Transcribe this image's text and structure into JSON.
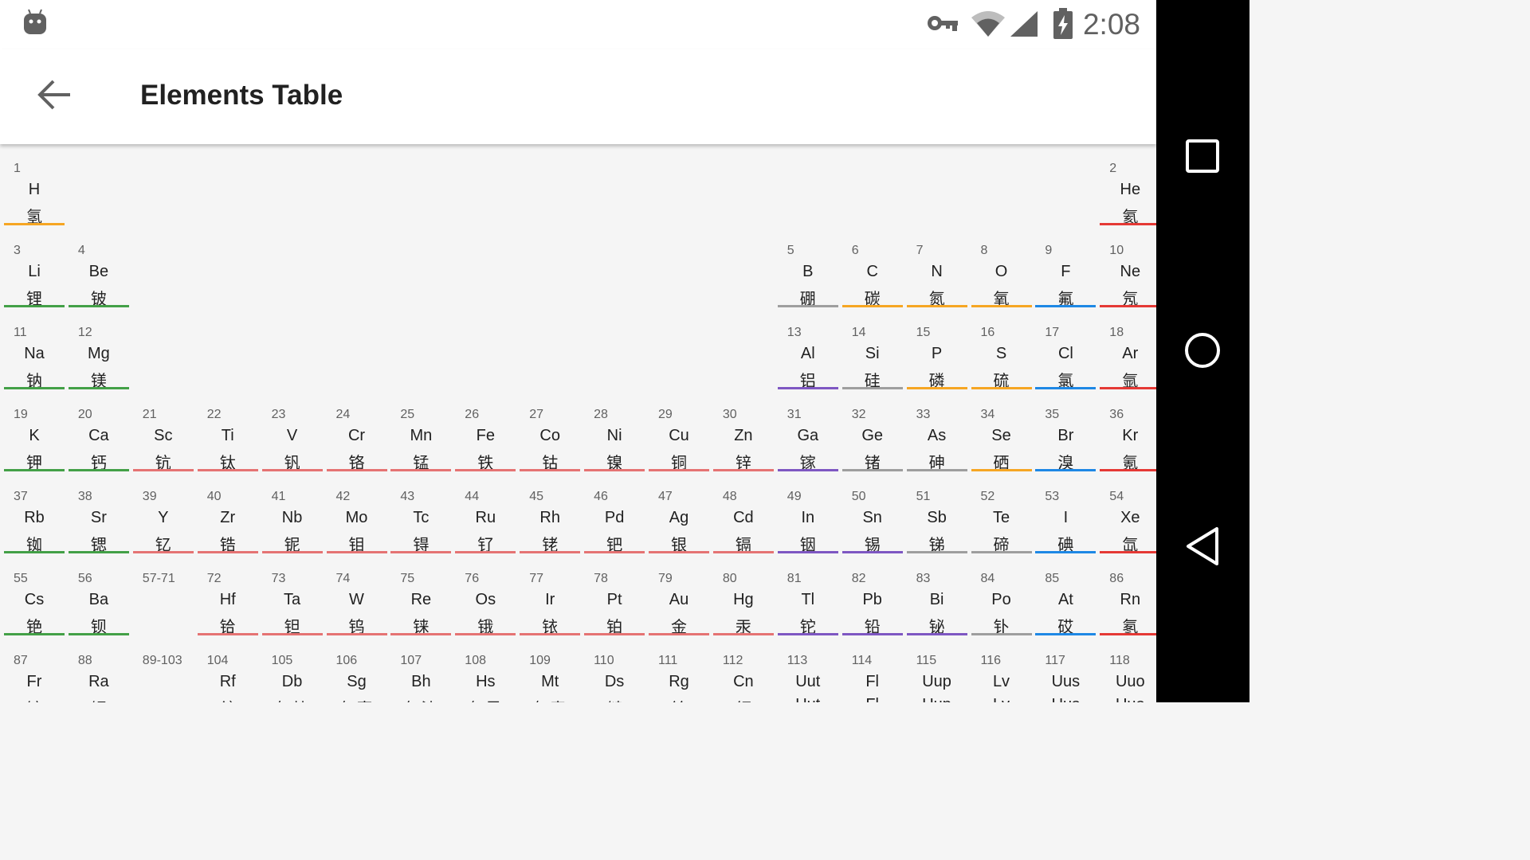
{
  "status_bar": {
    "time": "2:08"
  },
  "app_bar": {
    "title": "Elements Table"
  },
  "colors": {
    "h": "#f6a623",
    "nonmetal": "#f6a623",
    "noble": "#e53935",
    "alkali": "#43a047",
    "alkaline": "#43a047",
    "transition": "#e57373",
    "metalloid": "#9e9e9e",
    "post": "#7e57c2",
    "halogen": "#1e88e5",
    "none": "transparent"
  },
  "elements": [
    {
      "n": "1",
      "s": "H",
      "c": "氢",
      "row": 0,
      "col": 0,
      "cat": "h"
    },
    {
      "n": "2",
      "s": "He",
      "c": "氦",
      "row": 0,
      "col": 17,
      "cat": "noble"
    },
    {
      "n": "3",
      "s": "Li",
      "c": "锂",
      "row": 1,
      "col": 0,
      "cat": "alkali"
    },
    {
      "n": "4",
      "s": "Be",
      "c": "铍",
      "row": 1,
      "col": 1,
      "cat": "alkaline"
    },
    {
      "n": "5",
      "s": "B",
      "c": "硼",
      "row": 1,
      "col": 12,
      "cat": "metalloid"
    },
    {
      "n": "6",
      "s": "C",
      "c": "碳",
      "row": 1,
      "col": 13,
      "cat": "nonmetal"
    },
    {
      "n": "7",
      "s": "N",
      "c": "氮",
      "row": 1,
      "col": 14,
      "cat": "nonmetal"
    },
    {
      "n": "8",
      "s": "O",
      "c": "氧",
      "row": 1,
      "col": 15,
      "cat": "nonmetal"
    },
    {
      "n": "9",
      "s": "F",
      "c": "氟",
      "row": 1,
      "col": 16,
      "cat": "halogen"
    },
    {
      "n": "10",
      "s": "Ne",
      "c": "氖",
      "row": 1,
      "col": 17,
      "cat": "noble"
    },
    {
      "n": "11",
      "s": "Na",
      "c": "钠",
      "row": 2,
      "col": 0,
      "cat": "alkali"
    },
    {
      "n": "12",
      "s": "Mg",
      "c": "镁",
      "row": 2,
      "col": 1,
      "cat": "alkaline"
    },
    {
      "n": "13",
      "s": "Al",
      "c": "铝",
      "row": 2,
      "col": 12,
      "cat": "post"
    },
    {
      "n": "14",
      "s": "Si",
      "c": "硅",
      "row": 2,
      "col": 13,
      "cat": "metalloid"
    },
    {
      "n": "15",
      "s": "P",
      "c": "磷",
      "row": 2,
      "col": 14,
      "cat": "nonmetal"
    },
    {
      "n": "16",
      "s": "S",
      "c": "硫",
      "row": 2,
      "col": 15,
      "cat": "nonmetal"
    },
    {
      "n": "17",
      "s": "Cl",
      "c": "氯",
      "row": 2,
      "col": 16,
      "cat": "halogen"
    },
    {
      "n": "18",
      "s": "Ar",
      "c": "氩",
      "row": 2,
      "col": 17,
      "cat": "noble"
    },
    {
      "n": "19",
      "s": "K",
      "c": "钾",
      "row": 3,
      "col": 0,
      "cat": "alkali"
    },
    {
      "n": "20",
      "s": "Ca",
      "c": "钙",
      "row": 3,
      "col": 1,
      "cat": "alkaline"
    },
    {
      "n": "21",
      "s": "Sc",
      "c": "钪",
      "row": 3,
      "col": 2,
      "cat": "transition"
    },
    {
      "n": "22",
      "s": "Ti",
      "c": "钛",
      "row": 3,
      "col": 3,
      "cat": "transition"
    },
    {
      "n": "23",
      "s": "V",
      "c": "钒",
      "row": 3,
      "col": 4,
      "cat": "transition"
    },
    {
      "n": "24",
      "s": "Cr",
      "c": "铬",
      "row": 3,
      "col": 5,
      "cat": "transition"
    },
    {
      "n": "25",
      "s": "Mn",
      "c": "锰",
      "row": 3,
      "col": 6,
      "cat": "transition"
    },
    {
      "n": "26",
      "s": "Fe",
      "c": "铁",
      "row": 3,
      "col": 7,
      "cat": "transition"
    },
    {
      "n": "27",
      "s": "Co",
      "c": "钴",
      "row": 3,
      "col": 8,
      "cat": "transition"
    },
    {
      "n": "28",
      "s": "Ni",
      "c": "镍",
      "row": 3,
      "col": 9,
      "cat": "transition"
    },
    {
      "n": "29",
      "s": "Cu",
      "c": "铜",
      "row": 3,
      "col": 10,
      "cat": "transition"
    },
    {
      "n": "30",
      "s": "Zn",
      "c": "锌",
      "row": 3,
      "col": 11,
      "cat": "transition"
    },
    {
      "n": "31",
      "s": "Ga",
      "c": "镓",
      "row": 3,
      "col": 12,
      "cat": "post"
    },
    {
      "n": "32",
      "s": "Ge",
      "c": "锗",
      "row": 3,
      "col": 13,
      "cat": "metalloid"
    },
    {
      "n": "33",
      "s": "As",
      "c": "砷",
      "row": 3,
      "col": 14,
      "cat": "metalloid"
    },
    {
      "n": "34",
      "s": "Se",
      "c": "硒",
      "row": 3,
      "col": 15,
      "cat": "nonmetal"
    },
    {
      "n": "35",
      "s": "Br",
      "c": "溴",
      "row": 3,
      "col": 16,
      "cat": "halogen"
    },
    {
      "n": "36",
      "s": "Kr",
      "c": "氪",
      "row": 3,
      "col": 17,
      "cat": "noble"
    },
    {
      "n": "37",
      "s": "Rb",
      "c": "铷",
      "row": 4,
      "col": 0,
      "cat": "alkali"
    },
    {
      "n": "38",
      "s": "Sr",
      "c": "锶",
      "row": 4,
      "col": 1,
      "cat": "alkaline"
    },
    {
      "n": "39",
      "s": "Y",
      "c": "钇",
      "row": 4,
      "col": 2,
      "cat": "transition"
    },
    {
      "n": "40",
      "s": "Zr",
      "c": "锆",
      "row": 4,
      "col": 3,
      "cat": "transition"
    },
    {
      "n": "41",
      "s": "Nb",
      "c": "铌",
      "row": 4,
      "col": 4,
      "cat": "transition"
    },
    {
      "n": "42",
      "s": "Mo",
      "c": "钼",
      "row": 4,
      "col": 5,
      "cat": "transition"
    },
    {
      "n": "43",
      "s": "Tc",
      "c": "锝",
      "row": 4,
      "col": 6,
      "cat": "transition"
    },
    {
      "n": "44",
      "s": "Ru",
      "c": "钌",
      "row": 4,
      "col": 7,
      "cat": "transition"
    },
    {
      "n": "45",
      "s": "Rh",
      "c": "铑",
      "row": 4,
      "col": 8,
      "cat": "transition"
    },
    {
      "n": "46",
      "s": "Pd",
      "c": "钯",
      "row": 4,
      "col": 9,
      "cat": "transition"
    },
    {
      "n": "47",
      "s": "Ag",
      "c": "银",
      "row": 4,
      "col": 10,
      "cat": "transition"
    },
    {
      "n": "48",
      "s": "Cd",
      "c": "镉",
      "row": 4,
      "col": 11,
      "cat": "transition"
    },
    {
      "n": "49",
      "s": "In",
      "c": "铟",
      "row": 4,
      "col": 12,
      "cat": "post"
    },
    {
      "n": "50",
      "s": "Sn",
      "c": "锡",
      "row": 4,
      "col": 13,
      "cat": "post"
    },
    {
      "n": "51",
      "s": "Sb",
      "c": "锑",
      "row": 4,
      "col": 14,
      "cat": "metalloid"
    },
    {
      "n": "52",
      "s": "Te",
      "c": "碲",
      "row": 4,
      "col": 15,
      "cat": "metalloid"
    },
    {
      "n": "53",
      "s": "I",
      "c": "碘",
      "row": 4,
      "col": 16,
      "cat": "halogen"
    },
    {
      "n": "54",
      "s": "Xe",
      "c": "氙",
      "row": 4,
      "col": 17,
      "cat": "noble"
    },
    {
      "n": "55",
      "s": "Cs",
      "c": "铯",
      "row": 5,
      "col": 0,
      "cat": "alkali"
    },
    {
      "n": "56",
      "s": "Ba",
      "c": "钡",
      "row": 5,
      "col": 1,
      "cat": "alkaline"
    },
    {
      "n": "57-71",
      "s": "",
      "c": "",
      "row": 5,
      "col": 2,
      "cat": "none"
    },
    {
      "n": "72",
      "s": "Hf",
      "c": "铪",
      "row": 5,
      "col": 3,
      "cat": "transition"
    },
    {
      "n": "73",
      "s": "Ta",
      "c": "钽",
      "row": 5,
      "col": 4,
      "cat": "transition"
    },
    {
      "n": "74",
      "s": "W",
      "c": "钨",
      "row": 5,
      "col": 5,
      "cat": "transition"
    },
    {
      "n": "75",
      "s": "Re",
      "c": "铼",
      "row": 5,
      "col": 6,
      "cat": "transition"
    },
    {
      "n": "76",
      "s": "Os",
      "c": "锇",
      "row": 5,
      "col": 7,
      "cat": "transition"
    },
    {
      "n": "77",
      "s": "Ir",
      "c": "铱",
      "row": 5,
      "col": 8,
      "cat": "transition"
    },
    {
      "n": "78",
      "s": "Pt",
      "c": "铂",
      "row": 5,
      "col": 9,
      "cat": "transition"
    },
    {
      "n": "79",
      "s": "Au",
      "c": "金",
      "row": 5,
      "col": 10,
      "cat": "transition"
    },
    {
      "n": "80",
      "s": "Hg",
      "c": "汞",
      "row": 5,
      "col": 11,
      "cat": "transition"
    },
    {
      "n": "81",
      "s": "Tl",
      "c": "铊",
      "row": 5,
      "col": 12,
      "cat": "post"
    },
    {
      "n": "82",
      "s": "Pb",
      "c": "铅",
      "row": 5,
      "col": 13,
      "cat": "post"
    },
    {
      "n": "83",
      "s": "Bi",
      "c": "铋",
      "row": 5,
      "col": 14,
      "cat": "post"
    },
    {
      "n": "84",
      "s": "Po",
      "c": "钋",
      "row": 5,
      "col": 15,
      "cat": "metalloid"
    },
    {
      "n": "85",
      "s": "At",
      "c": "砹",
      "row": 5,
      "col": 16,
      "cat": "halogen"
    },
    {
      "n": "86",
      "s": "Rn",
      "c": "氡",
      "row": 5,
      "col": 17,
      "cat": "noble"
    },
    {
      "n": "87",
      "s": "Fr",
      "c": "钫",
      "row": 6,
      "col": 0,
      "cat": "alkali"
    },
    {
      "n": "88",
      "s": "Ra",
      "c": "镭",
      "row": 6,
      "col": 1,
      "cat": "alkaline"
    },
    {
      "n": "89-103",
      "s": "",
      "c": "",
      "row": 6,
      "col": 2,
      "cat": "none"
    },
    {
      "n": "104",
      "s": "Rf",
      "c": "鈩",
      "row": 6,
      "col": 3,
      "cat": "transition"
    },
    {
      "n": "105",
      "s": "Db",
      "c": "(钅杜)",
      "row": 6,
      "col": 4,
      "cat": "transition"
    },
    {
      "n": "106",
      "s": "Sg",
      "c": "(钅喜)",
      "row": 6,
      "col": 5,
      "cat": "transition"
    },
    {
      "n": "107",
      "s": "Bh",
      "c": "(钅波)",
      "row": 6,
      "col": 6,
      "cat": "transition"
    },
    {
      "n": "108",
      "s": "Hs",
      "c": "(钅黑)",
      "row": 6,
      "col": 7,
      "cat": "transition"
    },
    {
      "n": "109",
      "s": "Mt",
      "c": "(钅麦)",
      "row": 6,
      "col": 8,
      "cat": "transition"
    },
    {
      "n": "110",
      "s": "Ds",
      "c": "鐽",
      "row": 6,
      "col": 9,
      "cat": "transition"
    },
    {
      "n": "111",
      "s": "Rg",
      "c": "錀",
      "row": 6,
      "col": 10,
      "cat": "transition"
    },
    {
      "n": "112",
      "s": "Cn",
      "c": "鎶",
      "row": 6,
      "col": 11,
      "cat": "transition"
    },
    {
      "n": "113",
      "s": "Uut",
      "c": "Uut",
      "row": 6,
      "col": 12,
      "cat": "post"
    },
    {
      "n": "114",
      "s": "Fl",
      "c": "Fl",
      "row": 6,
      "col": 13,
      "cat": "post"
    },
    {
      "n": "115",
      "s": "Uup",
      "c": "Uup",
      "row": 6,
      "col": 14,
      "cat": "post"
    },
    {
      "n": "116",
      "s": "Lv",
      "c": "Lv",
      "row": 6,
      "col": 15,
      "cat": "post"
    },
    {
      "n": "117",
      "s": "Uus",
      "c": "Uus",
      "row": 6,
      "col": 16,
      "cat": "halogen"
    },
    {
      "n": "118",
      "s": "Uuo",
      "c": "Uuo",
      "row": 6,
      "col": 17,
      "cat": "noble"
    }
  ]
}
